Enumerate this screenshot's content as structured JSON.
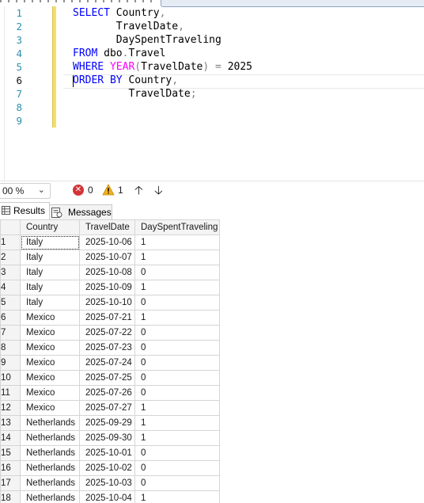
{
  "editor": {
    "lines": [
      {
        "num": "1",
        "tokens": [
          {
            "t": "SELECT",
            "c": "kw"
          },
          {
            "t": " Country",
            "c": "id"
          },
          {
            "t": ",",
            "c": "op"
          }
        ]
      },
      {
        "num": "2",
        "tokens": [
          {
            "t": "       TravelDate",
            "c": "id"
          },
          {
            "t": ",",
            "c": "op"
          }
        ]
      },
      {
        "num": "3",
        "tokens": [
          {
            "t": "       DaySpentTraveling",
            "c": "id"
          }
        ]
      },
      {
        "num": "4",
        "tokens": [
          {
            "t": "FROM",
            "c": "kw"
          },
          {
            "t": " dbo",
            "c": "id"
          },
          {
            "t": ".",
            "c": "op"
          },
          {
            "t": "Travel",
            "c": "id"
          }
        ]
      },
      {
        "num": "5",
        "tokens": [
          {
            "t": "WHERE",
            "c": "kw"
          },
          {
            "t": " ",
            "c": "id"
          },
          {
            "t": "YEAR",
            "c": "fn"
          },
          {
            "t": "(",
            "c": "op"
          },
          {
            "t": "TravelDate",
            "c": "id"
          },
          {
            "t": ")",
            "c": "op"
          },
          {
            "t": " = ",
            "c": "op"
          },
          {
            "t": "2025",
            "c": "id"
          }
        ]
      },
      {
        "num": "6",
        "tokens": [
          {
            "t": "ORDER BY",
            "c": "kw"
          },
          {
            "t": " Country",
            "c": "id"
          },
          {
            "t": ",",
            "c": "op"
          }
        ]
      },
      {
        "num": "7",
        "tokens": [
          {
            "t": "         TravelDate",
            "c": "id"
          },
          {
            "t": ";",
            "c": "op"
          }
        ]
      },
      {
        "num": "8",
        "tokens": []
      },
      {
        "num": "9",
        "tokens": []
      }
    ]
  },
  "statusbar": {
    "zoom": "00 %",
    "errors": "0",
    "warnings": "1"
  },
  "tabs": {
    "results_label": "Results",
    "messages_label": "Messages"
  },
  "grid": {
    "columns": [
      "Country",
      "TravelDate",
      "DaySpentTraveling"
    ],
    "rows": [
      [
        "1",
        "Italy",
        "2025-10-06",
        "1"
      ],
      [
        "2",
        "Italy",
        "2025-10-07",
        "1"
      ],
      [
        "3",
        "Italy",
        "2025-10-08",
        "0"
      ],
      [
        "4",
        "Italy",
        "2025-10-09",
        "1"
      ],
      [
        "5",
        "Italy",
        "2025-10-10",
        "0"
      ],
      [
        "6",
        "Mexico",
        "2025-07-21",
        "1"
      ],
      [
        "7",
        "Mexico",
        "2025-07-22",
        "0"
      ],
      [
        "8",
        "Mexico",
        "2025-07-23",
        "0"
      ],
      [
        "9",
        "Mexico",
        "2025-07-24",
        "0"
      ],
      [
        "10",
        "Mexico",
        "2025-07-25",
        "0"
      ],
      [
        "11",
        "Mexico",
        "2025-07-26",
        "0"
      ],
      [
        "12",
        "Mexico",
        "2025-07-27",
        "1"
      ],
      [
        "13",
        "Netherlands",
        "2025-09-29",
        "1"
      ],
      [
        "14",
        "Netherlands",
        "2025-09-30",
        "1"
      ],
      [
        "15",
        "Netherlands",
        "2025-10-01",
        "0"
      ],
      [
        "16",
        "Netherlands",
        "2025-10-02",
        "0"
      ],
      [
        "17",
        "Netherlands",
        "2025-10-03",
        "0"
      ],
      [
        "18",
        "Netherlands",
        "2025-10-04",
        "1"
      ]
    ]
  }
}
